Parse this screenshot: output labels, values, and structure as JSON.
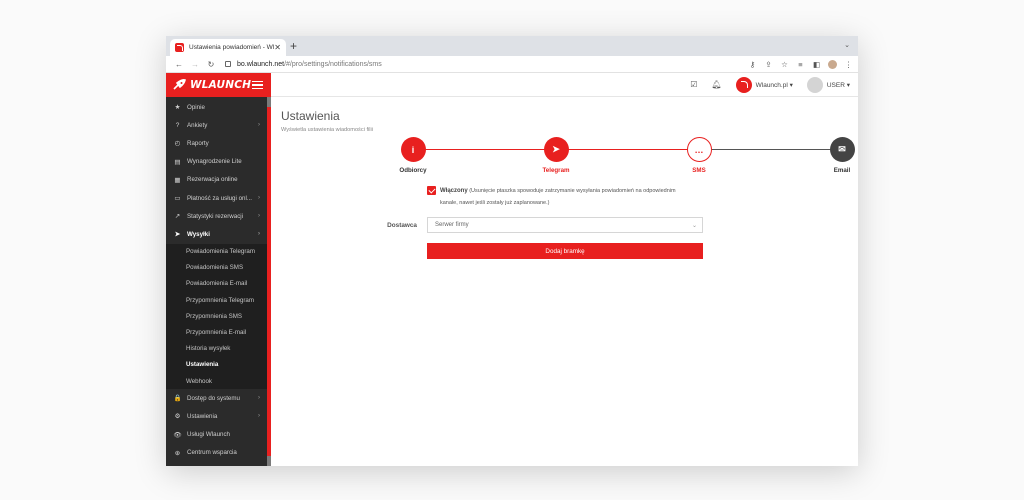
{
  "browser": {
    "tab_title": "Ustawienia powiadomień - Wla",
    "tab_close": "✕",
    "new_tab": "+",
    "tab_menu": "⌄",
    "back": "←",
    "forward": "→",
    "reload": "↻",
    "url_host": "bo.wlaunch.net",
    "url_path": "/#/pro/settings/notifications/sms",
    "toolbar_icons": [
      "key-icon",
      "share-icon",
      "star-icon",
      "playlist-icon",
      "sidebar-icon",
      "menu-icon"
    ]
  },
  "sidebar": {
    "brand": "WLAUNCH",
    "items": [
      {
        "icon": "★",
        "label": "Opinie",
        "chevron": ""
      },
      {
        "icon": "?",
        "label": "Ankiety",
        "chevron": "›"
      },
      {
        "icon": "◴",
        "label": "Raporty",
        "chevron": ""
      },
      {
        "icon": "▤",
        "label": "Wynagrodzenie Lite",
        "chevron": ""
      },
      {
        "icon": "▦",
        "label": "Rezerwacja online",
        "chevron": ""
      },
      {
        "icon": "▭",
        "label": "Płatność za usługi onl...",
        "chevron": "›"
      },
      {
        "icon": "↗",
        "label": "Statystyki rezerwacji",
        "chevron": "›"
      },
      {
        "icon": "➤",
        "label": "Wysyłki",
        "chevron": "›"
      }
    ],
    "sub_items": [
      "Powiadomienia  Telegram",
      "Powiadomienia  SMS",
      "Powiadomienia  E-mail",
      "Przypomnienia  Telegram",
      "Przypomnienia  SMS",
      "Przypomnienia  E-mail",
      "Historia wysyłek",
      "Ustawienia",
      "Webhook"
    ],
    "bottom_items": [
      {
        "icon": "🔒",
        "label": "Dostęp do systemu",
        "chevron": "›"
      },
      {
        "icon": "⚙",
        "label": "Ustawienia",
        "chevron": "›"
      },
      {
        "icon": "👁",
        "label": "Usługi Wlaunch",
        "chevron": ""
      },
      {
        "icon": "⊕",
        "label": "Centrum wsparcia",
        "chevron": ""
      }
    ]
  },
  "topbar": {
    "brand_name": "Wlaunch.pl ▾",
    "user_name": "USER ▾"
  },
  "page": {
    "title": "Ustawienia",
    "subtitle": "Wyświetla ustawienia wiadomości filii"
  },
  "steps": [
    {
      "label": "Odbiorcy",
      "glyph": "i",
      "style": "filled",
      "color": "#333333"
    },
    {
      "label": "Telegram",
      "glyph": "➤",
      "style": "filled",
      "color": "#e8201f"
    },
    {
      "label": "SMS",
      "glyph": "…",
      "style": "outline",
      "color": "#e8201f"
    },
    {
      "label": "Email",
      "glyph": "✉",
      "style": "dark",
      "color": "#333333"
    }
  ],
  "form": {
    "enabled_label": "Włączony",
    "enabled_note_1": "(Usunięcie ptaszka spowoduje zatrzymanie wysyłania powiadomień na odpowiednim",
    "enabled_note_2": "kanale, nawet jeśli zostały już zaplanowane.)",
    "provider_label": "Dostawca",
    "provider_value": "Serwer firmy",
    "add_button": "Dodaj bramkę"
  },
  "colors": {
    "accent": "#e8201f",
    "sidebar": "#2b2b2b",
    "sidebar_sub": "#1f1f1f"
  }
}
